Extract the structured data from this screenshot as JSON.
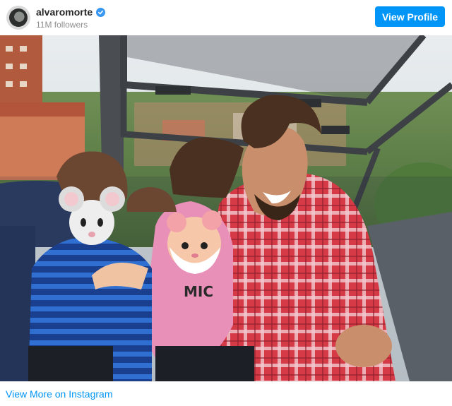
{
  "header": {
    "username": "alvaromorte",
    "followers": "11M followers",
    "view_profile_label": "View Profile"
  },
  "icons": {
    "verified": "verified-badge-icon",
    "avatar": "profile-avatar"
  },
  "colors": {
    "accent": "#0095f6",
    "verified": "#3897f0",
    "secondary_text": "#8e8e8e"
  },
  "footer": {
    "view_more_label": "View More on Instagram"
  }
}
